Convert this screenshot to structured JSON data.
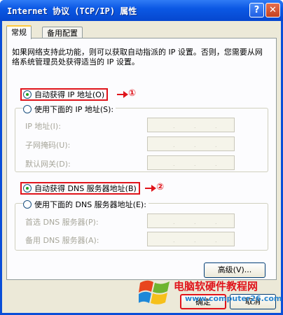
{
  "window": {
    "title": "Internet 协议 (TCP/IP) 属性",
    "help_label": "?",
    "close_label": "✕"
  },
  "tabs": [
    {
      "label": "常规"
    },
    {
      "label": "备用配置"
    }
  ],
  "description": "如果网络支持此功能，则可以获取自动指派的 IP 设置。否则，您需要从网络系统管理员处获得适当的 IP 设置。",
  "ip": {
    "auto_label": "自动获得 IP 地址(O)",
    "manual_label": "使用下面的 IP 地址(S):",
    "auto_selected": true,
    "fields": [
      {
        "label": "IP 地址(I):",
        "value": ". . ."
      },
      {
        "label": "子网掩码(U):",
        "value": ". . ."
      },
      {
        "label": "默认网关(D):",
        "value": ". . ."
      }
    ]
  },
  "dns": {
    "auto_label": "自动获得 DNS 服务器地址(B)",
    "manual_label": "使用下面的 DNS 服务器地址(E):",
    "auto_selected": true,
    "fields": [
      {
        "label": "首选 DNS 服务器(P):",
        "value": ". . ."
      },
      {
        "label": "备用 DNS 服务器(A):",
        "value": ". . ."
      }
    ]
  },
  "annotations": {
    "marker1": "①",
    "marker2": "②"
  },
  "buttons": {
    "advanced": "高级(V)...",
    "ok": "确定",
    "cancel": "取消"
  },
  "watermark": {
    "text": "电脑软硬件教程网",
    "url": "www.computer26.com"
  },
  "colors": {
    "titlebar": "#0b58e4",
    "annotation": "#e0141b",
    "dialog_bg": "#ece9d8"
  }
}
